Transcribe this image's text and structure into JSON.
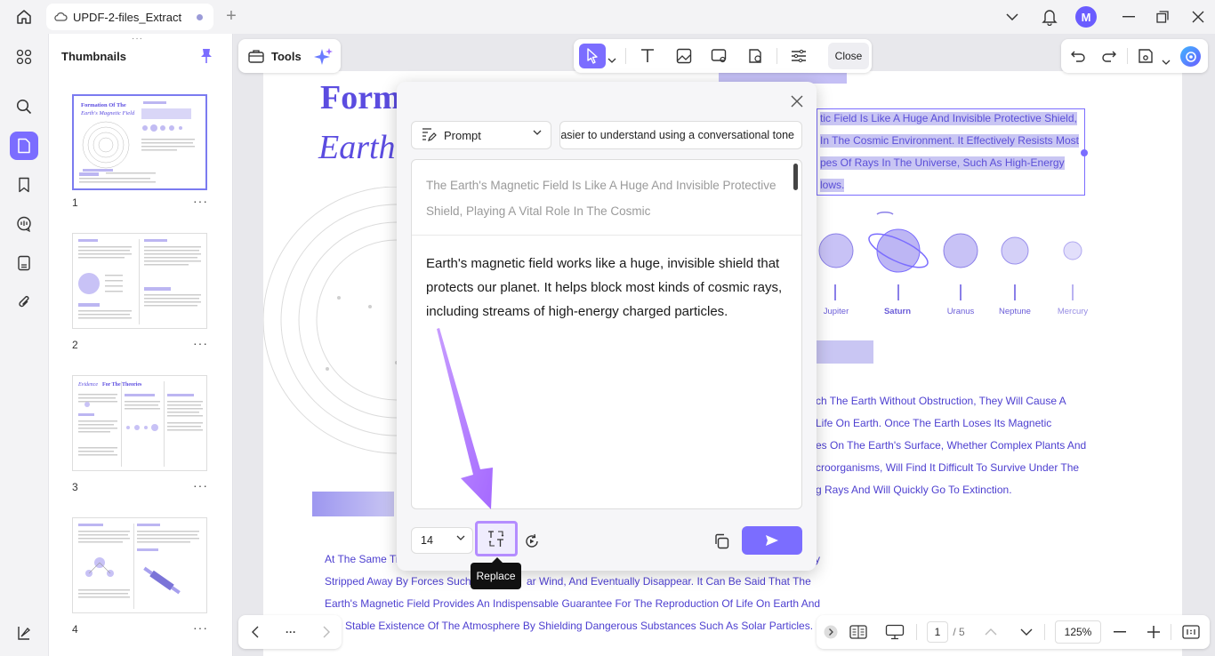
{
  "titlebar": {
    "tab_label": "UPDF-2-files_Extract",
    "avatar_letter": "M"
  },
  "thumbnails": {
    "title": "Thumbnails",
    "pages": [
      {
        "num": "1",
        "title_a": "Formation Of The",
        "title_b": "Earth's Magnetic Field"
      },
      {
        "num": "2"
      },
      {
        "num": "3",
        "title_a": "Evidence",
        "title_b": "For The Theories"
      },
      {
        "num": "4"
      }
    ],
    "more": "···"
  },
  "toolbar": {
    "tools_label": "Tools",
    "close_label": "Close"
  },
  "document": {
    "title_line1": "Form",
    "title_line2": "Earth",
    "selected_lines": [
      "tic Field Is Like A Huge And Invisible Protective Shield,",
      "In The Cosmic Environment. It Effectively Resists Most",
      "pes Of Rays In The Universe, Such As High-Energy",
      "lows."
    ],
    "planets": [
      "Jupiter",
      "Saturn",
      "Uranus",
      "Neptune",
      "Mercury"
    ],
    "body_right_lines": [
      "ch The Earth Without Obstruction, They Will Cause A",
      "Life On Earth. Once The Earth Loses Its Magnetic",
      "es On The Earth's Surface, Whether Complex Plants And",
      "croorganisms, Will Find It Difficult To Survive Under The",
      "g Rays And Will Quickly Go To Extinction."
    ],
    "body_bottom_lines": [
      "At The Same Ti",
      "y",
      "Stripped Away By Forces Such",
      "ar Wind, And Eventually Disappear. It Can Be Said That The",
      "Earth's Magnetic Field Provides An Indispensable Guarantee For The Reproduction Of Life On Earth And",
      "Stable Existence Of The Atmosphere By Shielding Dangerous Substances Such As Solar Particles."
    ]
  },
  "dialog": {
    "prompt_label": "Prompt",
    "prompt_value": "easier to understand using a conversational tone",
    "original_text": "The Earth's Magnetic Field Is Like A Huge And Invisible Protective Shield, Playing A Vital Role In The Cosmic",
    "result_text": "Earth's magnetic field works like a huge, invisible shield that protects our planet. It helps block most kinds of cosmic rays, including streams of high-energy charged particles.",
    "font_size": "14",
    "replace_tooltip": "Replace"
  },
  "bottom": {
    "prev_more": "···",
    "current_page": "1",
    "total_pages": "/ 5",
    "zoom": "125%"
  },
  "colors": {
    "accent": "#7b6dff",
    "doc_text": "#4d3fd0",
    "selection": "#c9c6f3"
  }
}
